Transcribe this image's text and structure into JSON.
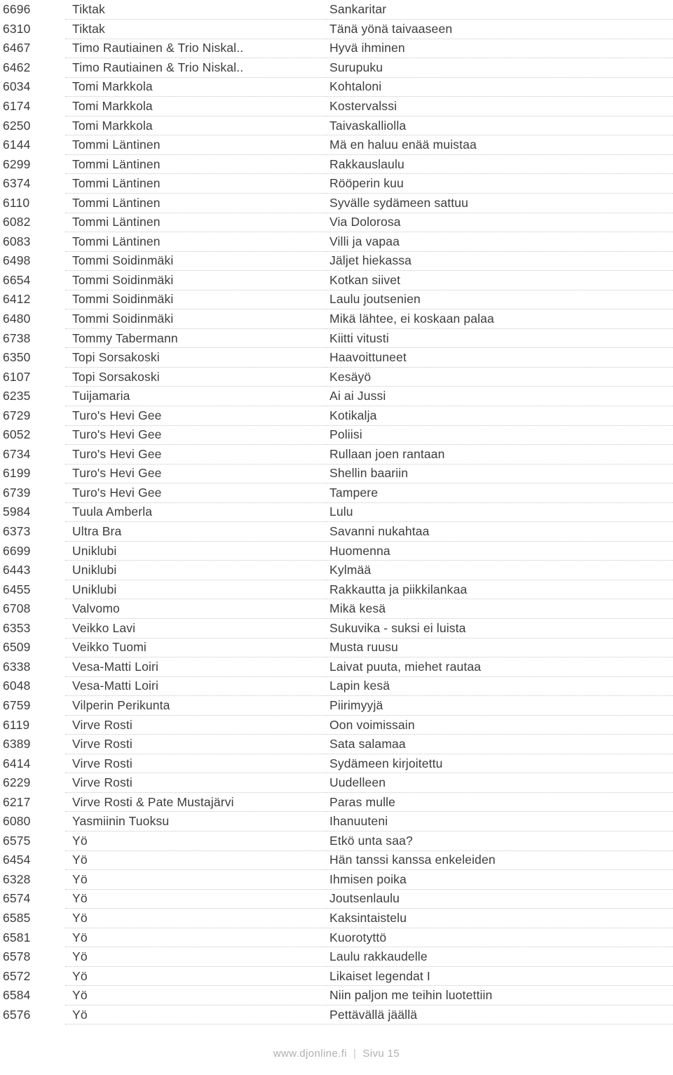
{
  "document": {
    "kind": "karaoke-song-catalog-page",
    "columns": [
      "id",
      "artist",
      "title"
    ]
  },
  "footer": {
    "site": "www.djonline.fi",
    "separator": "|",
    "page_label": "Sivu 15"
  },
  "rows": [
    {
      "id": "6696",
      "artist": "Tiktak",
      "title": "Sankaritar"
    },
    {
      "id": "6310",
      "artist": "Tiktak",
      "title": "Tänä yönä taivaaseen"
    },
    {
      "id": "6467",
      "artist": "Timo Rautiainen & Trio Niskal..",
      "title": "Hyvä ihminen"
    },
    {
      "id": "6462",
      "artist": "Timo Rautiainen & Trio Niskal..",
      "title": "Surupuku"
    },
    {
      "id": "6034",
      "artist": "Tomi Markkola",
      "title": "Kohtaloni"
    },
    {
      "id": "6174",
      "artist": "Tomi Markkola",
      "title": "Kostervalssi"
    },
    {
      "id": "6250",
      "artist": "Tomi Markkola",
      "title": "Taivaskalliolla"
    },
    {
      "id": "6144",
      "artist": "Tommi Läntinen",
      "title": "Mä en haluu enää muistaa"
    },
    {
      "id": "6299",
      "artist": "Tommi Läntinen",
      "title": "Rakkauslaulu"
    },
    {
      "id": "6374",
      "artist": "Tommi Läntinen",
      "title": "Rööperin kuu"
    },
    {
      "id": "6110",
      "artist": "Tommi Läntinen",
      "title": "Syvälle sydämeen sattuu"
    },
    {
      "id": "6082",
      "artist": "Tommi Läntinen",
      "title": "Via Dolorosa"
    },
    {
      "id": "6083",
      "artist": "Tommi Läntinen",
      "title": "Villi ja vapaa"
    },
    {
      "id": "6498",
      "artist": "Tommi Soidinmäki",
      "title": "Jäljet hiekassa"
    },
    {
      "id": "6654",
      "artist": "Tommi Soidinmäki",
      "title": "Kotkan siivet"
    },
    {
      "id": "6412",
      "artist": "Tommi Soidinmäki",
      "title": "Laulu joutsenien"
    },
    {
      "id": "6480",
      "artist": "Tommi Soidinmäki",
      "title": "Mikä lähtee, ei koskaan palaa"
    },
    {
      "id": "6738",
      "artist": "Tommy Tabermann",
      "title": "Kiitti vitusti"
    },
    {
      "id": "6350",
      "artist": "Topi Sorsakoski",
      "title": "Haavoittuneet"
    },
    {
      "id": "6107",
      "artist": "Topi Sorsakoski",
      "title": "Kesäyö"
    },
    {
      "id": "6235",
      "artist": "Tuijamaria",
      "title": "Ai ai Jussi"
    },
    {
      "id": "6729",
      "artist": "Turo's Hevi Gee",
      "title": "Kotikalja"
    },
    {
      "id": "6052",
      "artist": "Turo's Hevi Gee",
      "title": "Poliisi"
    },
    {
      "id": "6734",
      "artist": "Turo's Hevi Gee",
      "title": "Rullaan joen rantaan"
    },
    {
      "id": "6199",
      "artist": "Turo's Hevi Gee",
      "title": "Shellin baariin"
    },
    {
      "id": "6739",
      "artist": "Turo's Hevi Gee",
      "title": "Tampere"
    },
    {
      "id": "5984",
      "artist": "Tuula Amberla",
      "title": "Lulu"
    },
    {
      "id": "6373",
      "artist": "Ultra Bra",
      "title": "Savanni nukahtaa"
    },
    {
      "id": "6699",
      "artist": "Uniklubi",
      "title": "Huomenna"
    },
    {
      "id": "6443",
      "artist": "Uniklubi",
      "title": "Kylmää"
    },
    {
      "id": "6455",
      "artist": "Uniklubi",
      "title": "Rakkautta ja piikkilankaa"
    },
    {
      "id": "6708",
      "artist": "Valvomo",
      "title": "Mikä kesä"
    },
    {
      "id": "6353",
      "artist": "Veikko Lavi",
      "title": "Sukuvika - suksi ei luista"
    },
    {
      "id": "6509",
      "artist": "Veikko Tuomi",
      "title": "Musta ruusu"
    },
    {
      "id": "6338",
      "artist": "Vesa-Matti Loiri",
      "title": "Laivat puuta, miehet rautaa"
    },
    {
      "id": "6048",
      "artist": "Vesa-Matti Loiri",
      "title": "Lapin kesä"
    },
    {
      "id": "6759",
      "artist": "Vilperin Perikunta",
      "title": "Piirimyyjä"
    },
    {
      "id": "6119",
      "artist": "Virve Rosti",
      "title": "Oon voimissain"
    },
    {
      "id": "6389",
      "artist": "Virve Rosti",
      "title": "Sata salamaa"
    },
    {
      "id": "6414",
      "artist": "Virve Rosti",
      "title": "Sydämeen kirjoitettu"
    },
    {
      "id": "6229",
      "artist": "Virve Rosti",
      "title": "Uudelleen"
    },
    {
      "id": "6217",
      "artist": "Virve Rosti & Pate Mustajärvi",
      "title": "Paras mulle"
    },
    {
      "id": "6080",
      "artist": "Yasmiinin Tuoksu",
      "title": "Ihanuuteni"
    },
    {
      "id": "6575",
      "artist": "Yö",
      "title": "Etkö unta saa?"
    },
    {
      "id": "6454",
      "artist": "Yö",
      "title": "Hän tanssi kanssa enkeleiden"
    },
    {
      "id": "6328",
      "artist": "Yö",
      "title": "Ihmisen poika"
    },
    {
      "id": "6574",
      "artist": "Yö",
      "title": "Joutsenlaulu"
    },
    {
      "id": "6585",
      "artist": "Yö",
      "title": "Kaksintaistelu"
    },
    {
      "id": "6581",
      "artist": "Yö",
      "title": "Kuorotyttö"
    },
    {
      "id": "6578",
      "artist": "Yö",
      "title": "Laulu rakkaudelle"
    },
    {
      "id": "6572",
      "artist": "Yö",
      "title": "Likaiset legendat I"
    },
    {
      "id": "6584",
      "artist": "Yö",
      "title": "Niin paljon me teihin luotettiin"
    },
    {
      "id": "6576",
      "artist": "Yö",
      "title": "Pettävällä jäällä"
    }
  ]
}
